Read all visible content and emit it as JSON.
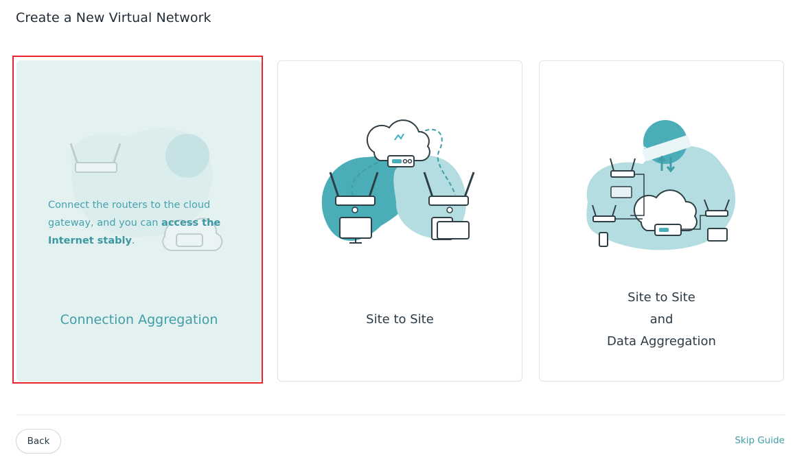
{
  "header": {
    "title": "Create a New Virtual Network"
  },
  "options": [
    {
      "label": "Connection Aggregation",
      "description": {
        "part1": "Connect the routers to the cloud gateway, and you can ",
        "bold": "access the Internet stably",
        "part2": "."
      },
      "selected": true
    },
    {
      "label": "Site to Site"
    },
    {
      "label_lines": [
        "Site to Site",
        "and",
        "Data Aggregation"
      ]
    }
  ],
  "footer": {
    "back_label": "Back",
    "skip_label": "Skip Guide"
  },
  "colors": {
    "accent": "#3f9da7",
    "teal_dark": "#4aadb8",
    "teal_light": "#b4dde1",
    "selected_bg": "#e4f1f1",
    "selected_outline": "#e8242a"
  },
  "icons": [
    "router-icon",
    "cloud-gateway-icon",
    "monitor-icon",
    "tablet-icon",
    "globe-icon",
    "phone-icon",
    "sync-arrows-icon"
  ]
}
